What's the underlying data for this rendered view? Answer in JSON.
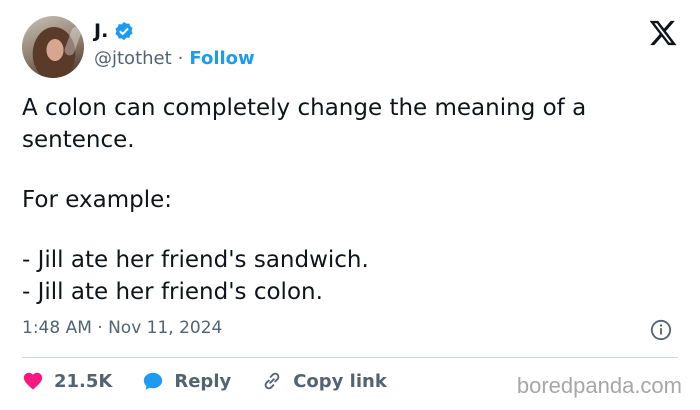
{
  "author": {
    "display_name": "J.",
    "handle": "@jtothet",
    "follow_label": "Follow",
    "separator": "·"
  },
  "tweet": {
    "line1": "A colon can completely change the meaning of a sentence.",
    "line2": "For example:",
    "line3": "- Jill ate her friend's sandwich.",
    "line4": "- Jill ate her friend's colon."
  },
  "timestamp": "1:48 AM · Nov 11, 2024",
  "actions": {
    "likes": "21.5K",
    "reply_label": "Reply",
    "copy_label": "Copy link"
  },
  "watermark": "boredpanda.com",
  "colors": {
    "accent": "#1d9bf0",
    "like": "#f91880",
    "text": "#0f1419",
    "muted": "#536471"
  },
  "icons": [
    "x-logo",
    "verified-badge",
    "info-icon",
    "heart-icon",
    "reply-bubble-icon",
    "link-icon"
  ]
}
